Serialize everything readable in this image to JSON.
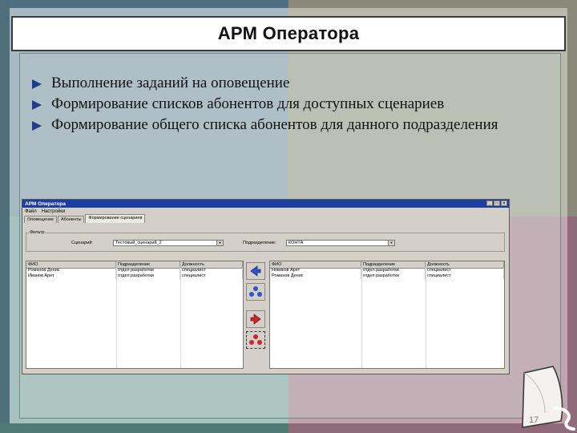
{
  "slide": {
    "title": "АРМ Оператора",
    "bullets": [
      "Выполнение заданий на оповещение",
      "Формирование списков абонентов для доступных сценариев",
      "Формирование общего списка абонентов для данного подразделения"
    ],
    "page_number": "17"
  },
  "app": {
    "window_title": "АРМ Оператора",
    "window_buttons": [
      "_",
      "□",
      "×"
    ],
    "menu": [
      "Файл",
      "Настройки"
    ],
    "tabs": [
      "Оповещение",
      "Абоненты",
      "Формирование сценариев"
    ],
    "active_tab": 2,
    "filter": {
      "legend": "Фильтр",
      "scenario_label": "Сценарий:",
      "scenario_value": "Тестовый_сценарий_2",
      "division_label": "Подразделение:",
      "division_value": "КОНТА"
    },
    "left_grid": {
      "columns": [
        "ФИО",
        "Подразделение",
        "Должность"
      ],
      "rows": [
        [
          "Романов Денис",
          "отдел разработки",
          "специалист"
        ],
        [
          "Иванов Арет",
          "отдел разработки",
          "специалист"
        ]
      ]
    },
    "right_grid": {
      "columns": [
        "ФИО",
        "Подразделение",
        "Должность"
      ],
      "rows": [
        [
          "Новиков Арет",
          "отдел разработки",
          "специалист"
        ],
        [
          "Романов Денис",
          "отдел разработки",
          "специалист"
        ]
      ]
    },
    "actions": [
      "move-left-icon",
      "move-all-icon",
      "add-icon",
      "delete-icon"
    ],
    "colors": {
      "title_bar": "#1a3fa0",
      "action_blue": "#2b56c7",
      "action_red": "#c8282d"
    }
  }
}
